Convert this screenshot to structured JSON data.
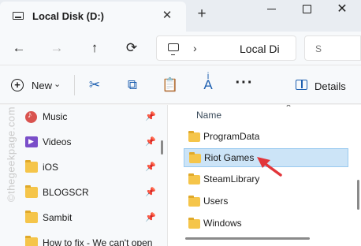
{
  "tab": {
    "title": "Local Disk (D:)",
    "close_glyph": "✕",
    "new_tab_glyph": "+"
  },
  "window": {
    "close_glyph": "✕"
  },
  "navigation": {
    "back_glyph": "←",
    "forward_glyph": "→",
    "up_glyph": "↑",
    "refresh_glyph": "⟳"
  },
  "address": {
    "separator": "›",
    "path_text": "Local Di"
  },
  "search": {
    "placeholder_fragment": "S"
  },
  "command_bar": {
    "new_label": "New",
    "new_chevron": "⌄",
    "cut_glyph": "✂",
    "copy_glyph": "⧉",
    "paste_glyph": "📋",
    "rename_glyph": "Aͥ",
    "more_glyph": "···",
    "details_label": "Details"
  },
  "sidebar": {
    "items": [
      {
        "label": "Music",
        "icon": "music-icon",
        "pinned": true
      },
      {
        "label": "Videos",
        "icon": "videos-icon",
        "pinned": true
      },
      {
        "label": "iOS",
        "icon": "folder-icon",
        "pinned": true
      },
      {
        "label": "BLOGSCR",
        "icon": "folder-icon",
        "pinned": true
      },
      {
        "label": "Sambit",
        "icon": "folder-icon",
        "pinned": true
      },
      {
        "label": "How to fix - We can't open",
        "icon": "folder-icon",
        "pinned": false
      }
    ],
    "pin_glyph": "📌"
  },
  "watermark": "©thegeekpage.com",
  "file_list": {
    "column_header": "Name",
    "sort_glyph": "⌃",
    "rows": [
      {
        "name": "ProgramData",
        "selected": false
      },
      {
        "name": "Riot Games",
        "selected": true
      },
      {
        "name": "SteamLibrary",
        "selected": false
      },
      {
        "name": "Users",
        "selected": false
      },
      {
        "name": "Windows",
        "selected": false
      }
    ]
  },
  "colors": {
    "accent": "#1d5fb0",
    "selection_bg": "#cce4f7",
    "selection_border": "#99c9ef",
    "folder": "#f5c54a",
    "annotation_arrow": "#e2353a"
  }
}
